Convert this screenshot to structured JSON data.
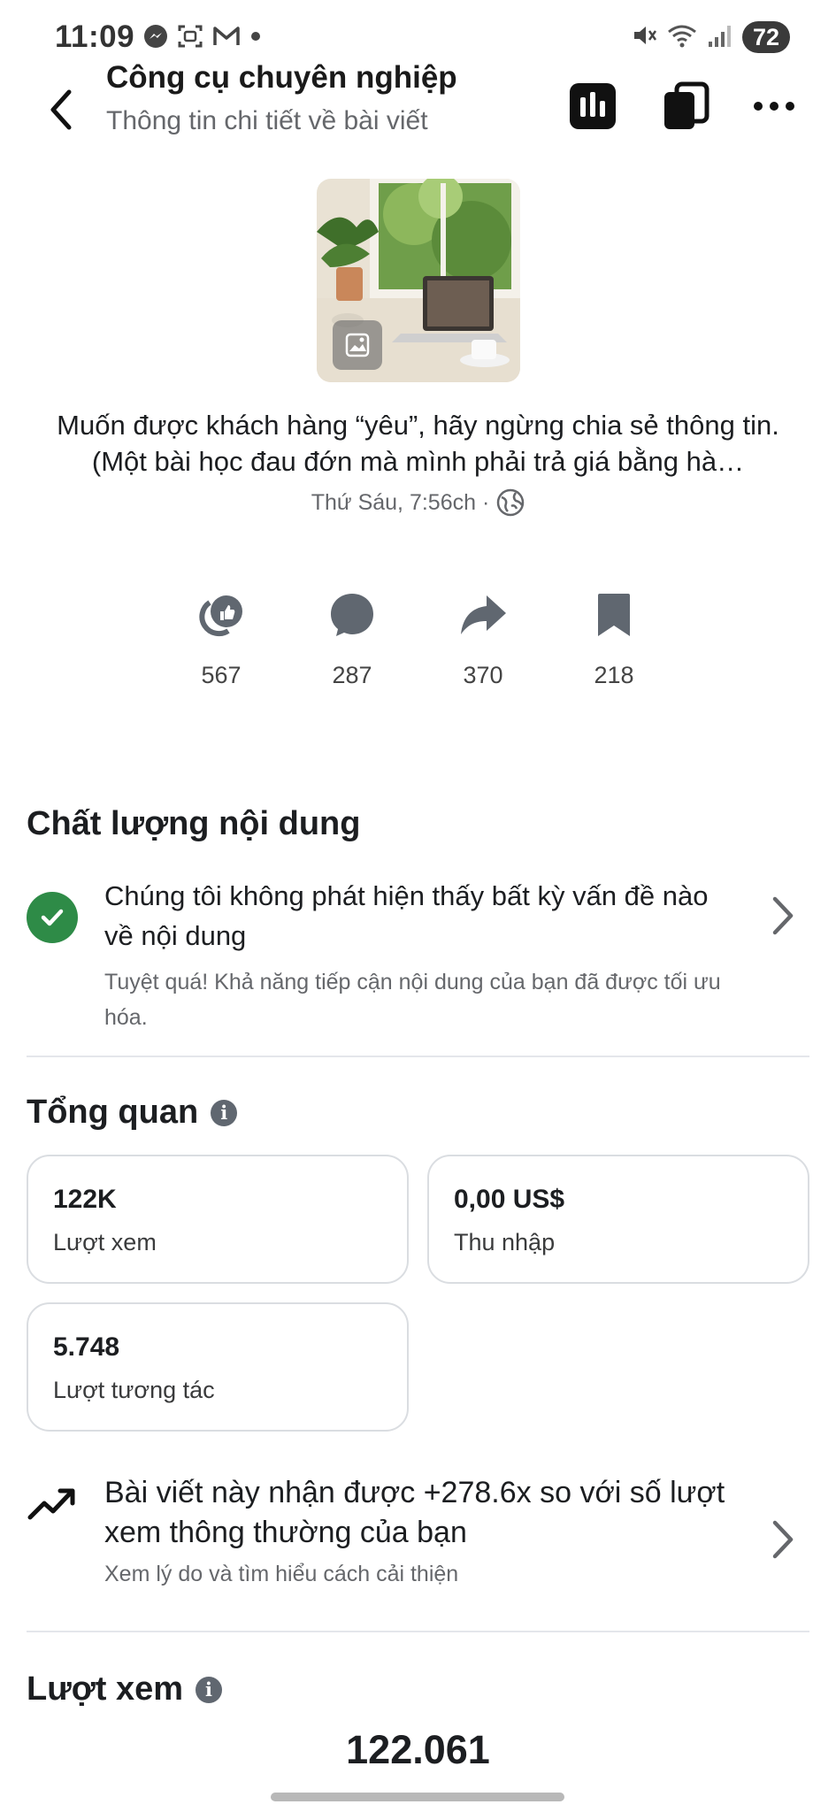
{
  "status_bar": {
    "time": "11:09",
    "battery": "72",
    "left_icons": [
      "messenger-icon",
      "screenshot-icon",
      "gmail-icon",
      "dot-icon"
    ],
    "right_icons": [
      "mute-icon",
      "wifi-icon",
      "signal-icon"
    ]
  },
  "header": {
    "title": "Công cụ chuyên nghiệp",
    "subtitle": "Thông tin chi tiết về bài viết"
  },
  "post": {
    "caption": "Muốn được khách hàng “yêu”, hãy ngừng chia sẻ thông tin. (Một bài học đau đớn mà mình phải trả giá bằng hà…",
    "meta": "Thứ Sáu, 7:56ch ·"
  },
  "stats": [
    {
      "icon": "reactions-icon",
      "value": "567"
    },
    {
      "icon": "comment-icon",
      "value": "287"
    },
    {
      "icon": "share-icon",
      "value": "370"
    },
    {
      "icon": "save-icon",
      "value": "218"
    }
  ],
  "quality": {
    "title": "Chất lượng nội dung",
    "message": "Chúng tôi không phát hiện thấy bất kỳ vấn đề nào về nội dung",
    "sub": "Tuyệt quá! Khả năng tiếp cận nội dung của bạn đã được tối ưu hóa."
  },
  "overview": {
    "title": "Tổng quan",
    "cards": [
      {
        "value": "122K",
        "label": "Lượt xem"
      },
      {
        "value": "0,00 US$",
        "label": "Thu nhập"
      },
      {
        "value": "5.748",
        "label": "Lượt tương tác"
      }
    ]
  },
  "trend": {
    "text": "Bài viết này nhận được +278.6x so với số lượt xem thông thường của bạn",
    "sub": "Xem lý do và tìm hiểu cách cải thiện"
  },
  "views": {
    "title": "Lượt xem",
    "total": "122.061"
  },
  "colors": {
    "success": "#2e8b47",
    "text": "#1c1e21",
    "muted": "#65676b",
    "card_border": "#dadde1"
  }
}
